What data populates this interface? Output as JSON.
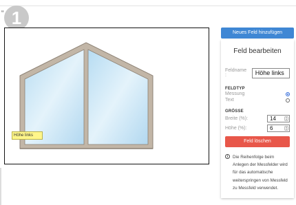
{
  "step_badge": "1",
  "canvas": {
    "field_label": "Höhe links"
  },
  "sidebar": {
    "add_button_label": "Neues Feld hinzufügen",
    "panel_title": "Feld bearbeiten",
    "name_label": "Feldname :",
    "name_value": "Höhe links",
    "type_section": "FELDTYP",
    "type_options": [
      {
        "label": "Messung",
        "selected": true
      },
      {
        "label": "Text",
        "selected": false
      }
    ],
    "size_section": "GRÖSSE",
    "width_label": "Breite (%):",
    "width_value": "14",
    "height_label": "Höhe (%):",
    "height_value": "6",
    "delete_button_label": "Feld löschen",
    "info_icon": "i",
    "info_text": "Die Reihenfolge beim Anlegen der Messfelder wird für das automatische weiterspringen von Messfeld zu Messfeld verwendet."
  },
  "colors": {
    "primary_button": "#3f87d4",
    "danger_button": "#e8574a",
    "field_highlight": "#fff68a",
    "window_frame": "#c2b6a7",
    "glass": "#cfe8f6"
  }
}
